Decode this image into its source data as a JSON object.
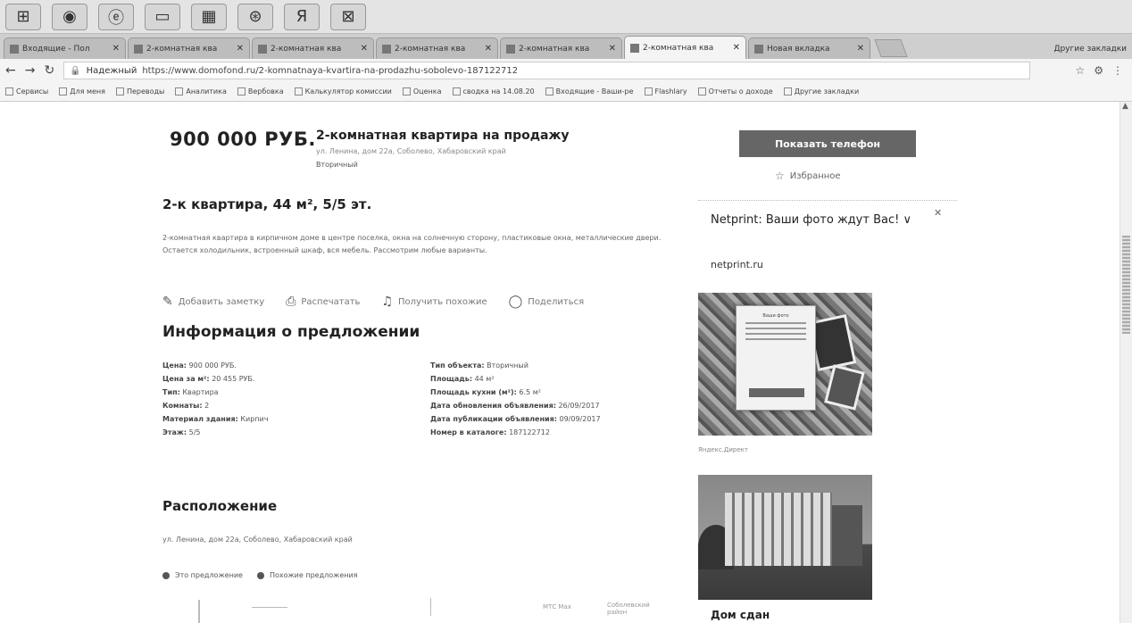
{
  "browser": {
    "tabs": [
      {
        "label": "Входящие - Пол",
        "active": false
      },
      {
        "label": "2-комнатная ква",
        "active": false
      },
      {
        "label": "2-комнатная ква",
        "active": false
      },
      {
        "label": "2-комнатная ква",
        "active": false
      },
      {
        "label": "2-комнатная ква",
        "active": false
      },
      {
        "label": "2-комнатная ква",
        "active": false
      },
      {
        "label": "Новая вкладка",
        "active": false
      }
    ],
    "tabs_right_label": "Другие закладки",
    "address": {
      "secure_label": "Надежный",
      "url": "https://www.domofond.ru/2-komnatnaya-kvartira-na-prodazhu-sobolevo-187122712"
    },
    "bookmarks": [
      "Сервисы",
      "Для меня",
      "Переводы",
      "Аналитика",
      "Вербовка",
      "Калькулятор комиссии",
      "Оценка",
      "сводка на 14.08.20",
      "Входящие - Ваши-ре",
      "Flashlary",
      "Отчеты о доходе"
    ],
    "bookmarks_other": "Другие закладки"
  },
  "listing": {
    "price": "900 000 РУБ.",
    "title": "2-комнатная квартира на продажу",
    "address": "ул. Ленина, дом 22а, Соболево, Хабаровский край",
    "type": "Вторичный",
    "headline": "2-к квартира, 44 м², 5/5 эт.",
    "description": "2-комнатная квартира в кирпичном доме в центре поселка, окна на солнечную сторону, пластиковые окна, металлические двери. Остается холодильник, встроенный шкаф, вся мебель. Рассмотрим любые варианты.",
    "actions": {
      "note": "Добавить заметку",
      "print": "Распечатать",
      "similar": "Получить похожие",
      "share": "Поделиться"
    }
  },
  "info": {
    "heading": "Информация о предложении",
    "left": [
      {
        "key": "Цена:",
        "value": "900 000 РУБ."
      },
      {
        "key": "Цена за м²:",
        "value": "20 455 РУБ."
      },
      {
        "key": "Тип:",
        "value": "Квартира"
      },
      {
        "key": "Комнаты:",
        "value": "2"
      },
      {
        "key": "Материал здания:",
        "value": "Кирпич"
      },
      {
        "key": "Этаж:",
        "value": "5/5"
      }
    ],
    "right": [
      {
        "key": "Тип объекта:",
        "value": "Вторичный"
      },
      {
        "key": "Площадь:",
        "value": "44 м²"
      },
      {
        "key": "Площадь кухни (м²):",
        "value": "6.5 м²"
      },
      {
        "key": "Дата обновления объявления:",
        "value": "26/09/2017"
      },
      {
        "key": "Дата публикации объявления:",
        "value": "09/09/2017"
      },
      {
        "key": "Номер в каталоге:",
        "value": "187122712"
      }
    ]
  },
  "location": {
    "heading": "Расположение",
    "address": "ул. Ленина, дом 22а, Соболево, Хабаровский край",
    "map_tabs": [
      "Это предложение",
      "Похожие предложения"
    ],
    "map_labels": [
      "МТС Мах",
      "Соболевский район"
    ]
  },
  "sidebar": {
    "call_button": "Показать телефон",
    "favorite": "Избранное",
    "ad": {
      "headline": "Netprint: Ваши фото ждут Вас! ∨",
      "domain": "netprint.ru",
      "popup_text": "Ваши фото",
      "source": "Яндекс.Директ"
    },
    "house_title": "Дом сдан"
  }
}
